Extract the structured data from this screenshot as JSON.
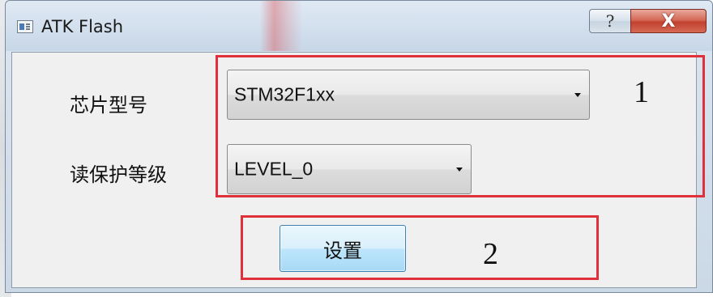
{
  "window": {
    "title": "ATK Flash",
    "help_label": "?",
    "close_label": "X"
  },
  "form": {
    "chip_model_label": "芯片型号",
    "chip_model_value": "STM32F1xx",
    "read_protect_label": "读保护等级",
    "read_protect_value": "LEVEL_0",
    "set_button_label": "设置"
  },
  "annotations": {
    "marker_1": "1",
    "marker_2": "2",
    "box_color": "#e0303a"
  },
  "icons": [
    "app-icon",
    "help-icon",
    "close-icon",
    "chevron-down-icon"
  ]
}
